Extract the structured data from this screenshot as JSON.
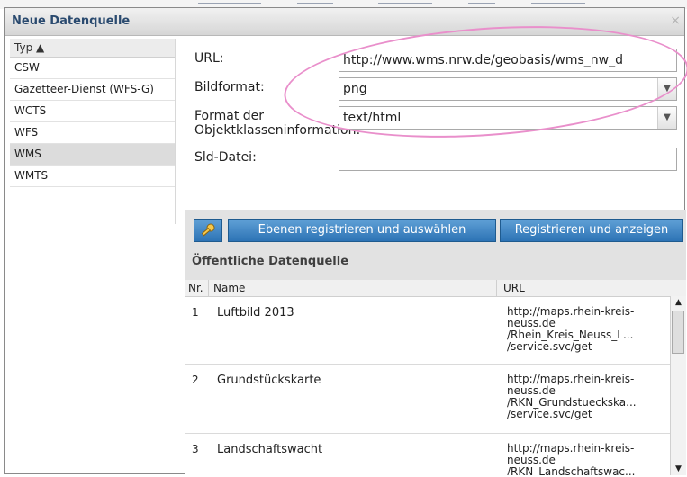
{
  "dialog": {
    "title": "Neue Datenquelle",
    "close_glyph": "×"
  },
  "types": {
    "header": "Typ ▲",
    "items": [
      "CSW",
      "Gazetteer-Dienst (WFS-G)",
      "WCTS",
      "WFS",
      "WMS",
      "WMTS"
    ],
    "selected": "WMS"
  },
  "form": {
    "url_label": "URL:",
    "url_value": "http://www.wms.nrw.de/geobasis/wms_nw_d",
    "image_format_label": "Bildformat:",
    "image_format_value": "png",
    "feature_info_label": "Format der Objektklasseninformation:",
    "feature_info_value": "text/html",
    "sld_label": "Sld-Datei:",
    "sld_value": ""
  },
  "buttons": {
    "key_icon": "key-icon",
    "register_select": "Ebenen registrieren und auswählen",
    "register_show": "Registrieren und anzeigen"
  },
  "public": {
    "title": "Öffentliche Datenquelle",
    "col_nr": "Nr.",
    "col_name": "Name",
    "col_url": "URL",
    "rows": [
      {
        "nr": "1",
        "name": "Luftbild 2013",
        "url": "http://maps.rhein-kreis-neuss.de /Rhein_Kreis_Neuss_L... /service.svc/get"
      },
      {
        "nr": "2",
        "name": "Grundstückskarte",
        "url": "http://maps.rhein-kreis-neuss.de /RKN_Grundstueckska... /service.svc/get"
      },
      {
        "nr": "3",
        "name": "Landschaftswacht",
        "url": "http://maps.rhein-kreis-neuss.de /RKN_Landschaftswac..."
      }
    ]
  },
  "colors": {
    "accent_button": "#2d73b5",
    "annotation": "#e98fcb"
  }
}
